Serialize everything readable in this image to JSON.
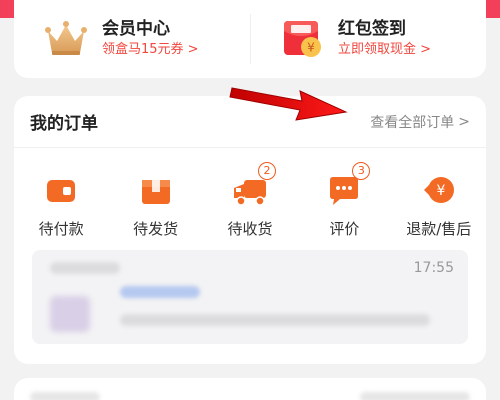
{
  "promo": {
    "membership": {
      "title": "会员中心",
      "subtitle": "领盒马15元券 >"
    },
    "redpacket": {
      "title": "红包签到",
      "subtitle": "立即领取现金 >"
    }
  },
  "orders": {
    "title": "我的订单",
    "view_all": "查看全部订单",
    "view_all_chevron": ">",
    "statuses": [
      {
        "label": "待付款",
        "icon": "wallet-icon"
      },
      {
        "label": "待发货",
        "icon": "package-icon"
      },
      {
        "label": "待收货",
        "icon": "truck-icon",
        "badge": "2"
      },
      {
        "label": "评价",
        "icon": "comment-icon",
        "badge": "3"
      },
      {
        "label": "退款/售后",
        "icon": "refund-icon"
      }
    ],
    "preview": {
      "time": "17:55"
    }
  },
  "colors": {
    "accent_red": "#f2405a",
    "orange": "#f05a1e",
    "promo_text": "#f0473e"
  }
}
